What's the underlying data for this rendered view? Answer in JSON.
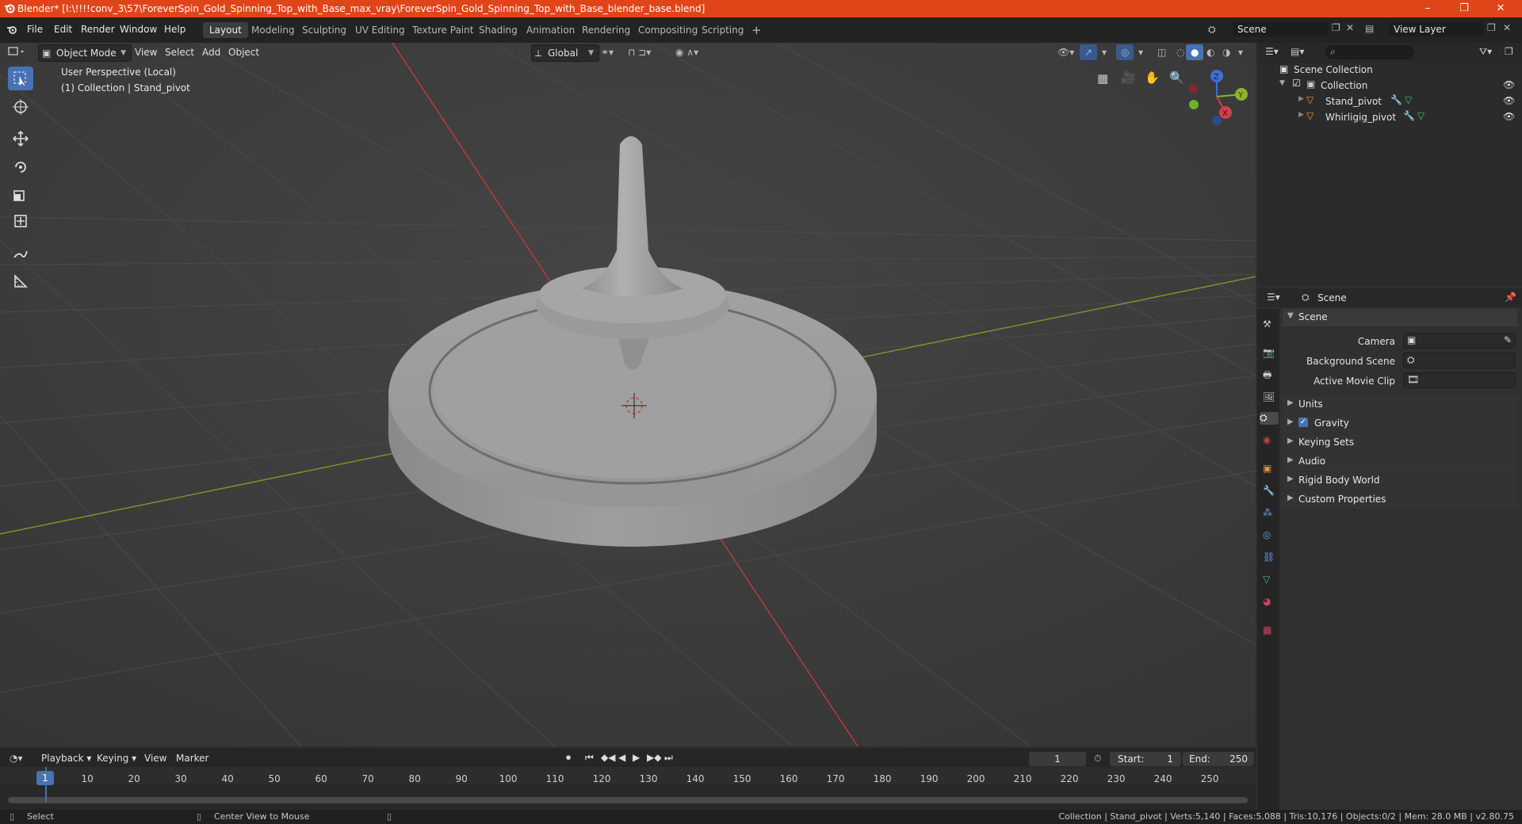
{
  "window": {
    "title": "Blender* [I:\\!!!!conv_3\\57\\ForeverSpin_Gold_Spinning_Top_with_Base_max_vray\\ForeverSpin_Gold_Spinning_Top_with_Base_blender_base.blend]",
    "minimize": "–",
    "maximize": "❐",
    "close": "✕"
  },
  "menu": {
    "file": "File",
    "edit": "Edit",
    "render": "Render",
    "window": "Window",
    "help": "Help"
  },
  "workspaces": [
    "Layout",
    "Modeling",
    "Sculpting",
    "UV Editing",
    "Texture Paint",
    "Shading",
    "Animation",
    "Rendering",
    "Compositing",
    "Scripting",
    "+"
  ],
  "scene_field": "Scene",
  "view_layer_field": "View Layer",
  "viewport": {
    "mode": "Object Mode",
    "menus": [
      "View",
      "Select",
      "Add",
      "Object"
    ],
    "transform_orientation": "Global",
    "info_line1": "User Perspective (Local)",
    "info_line2": "(1) Collection | Stand_pivot",
    "gizmo": {
      "x": "X",
      "y": "Y",
      "z": "Z"
    }
  },
  "outliner": {
    "search_placeholder": "",
    "root": "Scene Collection",
    "collection": "Collection",
    "objects": [
      "Stand_pivot",
      "Whirligig_pivot"
    ]
  },
  "properties": {
    "header": "Scene",
    "section": "Scene",
    "camera_label": "Camera",
    "background_scene_label": "Background Scene",
    "active_movie_clip_label": "Active Movie Clip",
    "panels": [
      "Units",
      "Gravity",
      "Keying Sets",
      "Audio",
      "Rigid Body World",
      "Custom Properties"
    ],
    "gravity_checked": true
  },
  "timeline": {
    "menus": [
      "Playback",
      "Keying",
      "View",
      "Marker"
    ],
    "current_frame": "1",
    "start_label": "Start:",
    "start_value": "1",
    "end_label": "End:",
    "end_value": "250",
    "ticks": [
      "10",
      "20",
      "30",
      "40",
      "50",
      "60",
      "70",
      "80",
      "90",
      "100",
      "110",
      "120",
      "130",
      "140",
      "150",
      "160",
      "170",
      "180",
      "190",
      "200",
      "210",
      "220",
      "230",
      "240",
      "250"
    ],
    "playhead_label": "1"
  },
  "status": {
    "left_action": "Select",
    "middle_action": "Center View to Mouse",
    "stats": "Collection | Stand_pivot | Verts:5,140 | Faces:5,088 | Tris:10,176 | Objects:0/2 | Mem: 28.0 MB | v2.80.75"
  },
  "colors": {
    "titlebar": "#e0451a",
    "accent": "#4772b3",
    "axis_x": "#c5383b",
    "axis_y": "#7a9b2a"
  }
}
